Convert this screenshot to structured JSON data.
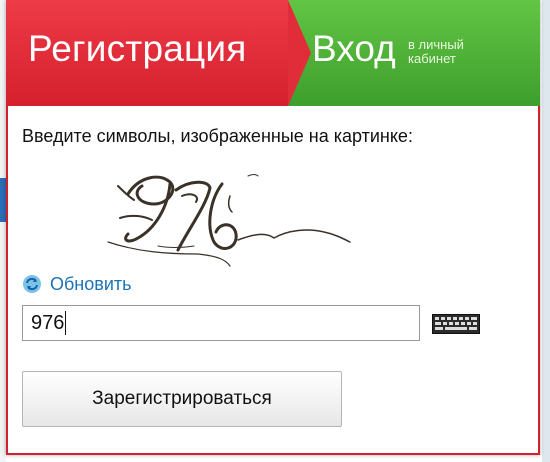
{
  "tabs": {
    "register": {
      "label": "Регистрация"
    },
    "login": {
      "label": "Вход",
      "sub_line1": "в личный",
      "sub_line2": "кабинет"
    }
  },
  "form": {
    "instruction": "Введите символы, изображенные на картинке:",
    "captcha_text": "976",
    "refresh_label": "Обновить",
    "input_value": "976",
    "submit_label": "Зарегистрироваться"
  },
  "colors": {
    "register_red": "#d51f2d",
    "login_green": "#4cb336",
    "link_blue": "#1a73b8"
  },
  "icons": {
    "refresh": "refresh-icon",
    "keyboard": "keyboard-icon"
  }
}
